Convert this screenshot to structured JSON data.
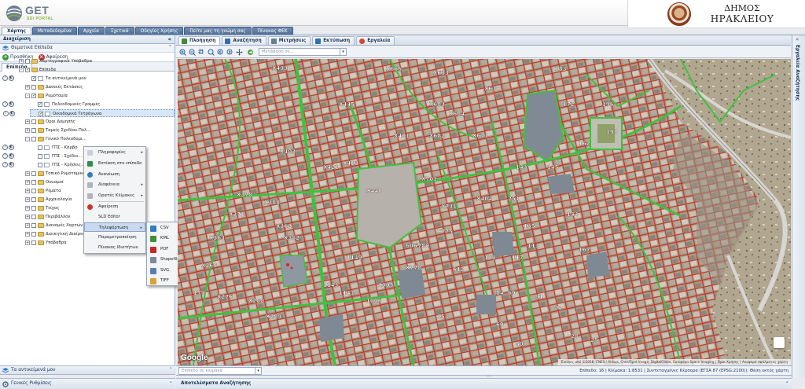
{
  "logo": {
    "name": "GET",
    "subtitle": "SDI PORTAL"
  },
  "brand": {
    "line1": "ΔΗΜΟΣ",
    "line2": "ΗΡΑΚΛΕΙΟΥ"
  },
  "topnav": [
    "Χάρτης",
    "Μεταδεδομένα",
    "Αρχεία",
    "Σχετικά",
    "Οδηγίες Χρήσης",
    "Πείτε μας τη γνώμη σας",
    "Πίνακας ΦΕΚ"
  ],
  "left": {
    "title": "Διαχείριση",
    "section": "Θεματικά Επίπεδα",
    "add_label": "Προσθήκη",
    "remove_label": "Αφαίρεση",
    "subtab": "Επίπεδα",
    "tree": [
      {
        "label": "Χαρτογραφικά Υπόβαθρα",
        "level": 0,
        "type": "folder",
        "expand": "+",
        "checked": false
      },
      {
        "label": "Επίπεδα",
        "level": 0,
        "type": "folder",
        "expand": "-",
        "checked": true
      },
      {
        "label": "Τα αντικείμενά μου",
        "level": 1,
        "type": "layer",
        "expand": "",
        "checked": true,
        "tools": true
      },
      {
        "label": "Δασικές Εκτάσεις",
        "level": 1,
        "type": "folder",
        "expand": "+",
        "checked": false
      },
      {
        "label": "Ρυμοτομία",
        "level": 1,
        "type": "folder",
        "expand": "-",
        "checked": true
      },
      {
        "label": "Πολεοδομικές Γραμμές",
        "level": 2,
        "type": "layer",
        "expand": "",
        "checked": true,
        "tools": true
      },
      {
        "label": "Οικοδομικά Τετράγωνα",
        "level": 2,
        "type": "layer",
        "expand": "",
        "checked": true,
        "tools": true,
        "selected": true
      },
      {
        "label": "Όροι Δόμησης",
        "level": 1,
        "type": "folder",
        "expand": "+",
        "checked": false
      },
      {
        "label": "Ταμείς Σχεδίου Πόλ...",
        "level": 1,
        "type": "folder",
        "expand": "+",
        "checked": false
      },
      {
        "label": "Γενικό Πολεοδομι...",
        "level": 1,
        "type": "folder",
        "expand": "-",
        "checked": false
      },
      {
        "label": "ΓΠΣ - Κάρβο",
        "level": 2,
        "type": "layer",
        "expand": "",
        "checked": false,
        "tools": true
      },
      {
        "label": "ΓΠΣ - Σχέδιο...",
        "level": 2,
        "type": "layer",
        "expand": "",
        "checked": false,
        "tools": true
      },
      {
        "label": "ΓΠΣ - Χρήσεις...",
        "level": 2,
        "type": "layer",
        "expand": "",
        "checked": false,
        "tools": true
      },
      {
        "label": "Τοπικό Ρυμοτομικό...",
        "level": 1,
        "type": "folder",
        "expand": "+",
        "checked": false
      },
      {
        "label": "Οικισμοί",
        "level": 1,
        "type": "folder",
        "expand": "+",
        "checked": false
      },
      {
        "label": "Ρέματα",
        "level": 1,
        "type": "folder",
        "expand": "+",
        "checked": false
      },
      {
        "label": "Αρχαιολογία",
        "level": 1,
        "type": "folder",
        "expand": "+",
        "checked": false
      },
      {
        "label": "Τείχος",
        "level": 1,
        "type": "folder",
        "expand": "+",
        "checked": false
      },
      {
        "label": "Περιβάλλον",
        "level": 1,
        "type": "folder",
        "expand": "+",
        "checked": false
      },
      {
        "label": "Διανομές Χαρτών",
        "level": 1,
        "type": "folder",
        "expand": "+",
        "checked": false
      },
      {
        "label": "Διοικητική Διαίρεση",
        "level": 1,
        "type": "folder",
        "expand": "+",
        "checked": false
      },
      {
        "label": "Υπόβαθρα",
        "level": 1,
        "type": "folder",
        "expand": "+",
        "checked": false
      }
    ],
    "objects_bar": "Τα αντικείμενά μου",
    "general_bar": "Γενικές Ρυθμίσεις"
  },
  "context_menu": [
    {
      "label": "Πληροφορίες",
      "icon": "info-icon",
      "submenu": true
    },
    {
      "label": "Εστίαση στο επίπεδο",
      "icon": "zoom-to-layer-icon",
      "submenu": false
    },
    {
      "label": "Ανανέωση",
      "icon": "refresh-icon",
      "submenu": false
    },
    {
      "label": "Διαφάνεια",
      "icon": "transparency-icon",
      "submenu": true
    },
    {
      "label": "Ορατές Κλίμακες",
      "icon": "scale-icon",
      "submenu": true
    },
    {
      "label": "Αφαίρεση",
      "icon": "remove-icon",
      "submenu": false
    },
    {
      "label": "SLD Editor",
      "icon": "",
      "submenu": false
    },
    {
      "label": "Τηλεφόρτωση",
      "icon": "",
      "submenu": true,
      "highlighted": true
    },
    {
      "label": "Παραμετροποίηση",
      "icon": "",
      "submenu": false
    },
    {
      "label": "Πίνακας Ιδιοτήτων",
      "icon": "",
      "submenu": false
    }
  ],
  "export_menu": [
    {
      "label": "CSV",
      "icon": "csv-icon",
      "color": "#2f7fc1"
    },
    {
      "label": "KML",
      "icon": "kml-icon",
      "color": "#3e8e3e"
    },
    {
      "label": "PDF",
      "icon": "pdf-icon",
      "color": "#c62828"
    },
    {
      "label": "Shapefile",
      "icon": "shapefile-icon",
      "color": "#7a8a9a"
    },
    {
      "label": "SVG",
      "icon": "svg-icon",
      "color": "#5d7db0"
    },
    {
      "label": "TIFF",
      "icon": "tiff-icon",
      "color": "#d8a13a"
    }
  ],
  "map_tabs": [
    {
      "label": "Πλοήγηση",
      "icon": "navigation-icon",
      "active": true
    },
    {
      "label": "Αναζήτηση",
      "icon": "search-icon",
      "active": false
    },
    {
      "label": "Μετρήσεις",
      "icon": "measure-icon",
      "active": false
    },
    {
      "label": "Εκτύπωση",
      "icon": "print-icon",
      "active": false
    },
    {
      "label": "Εργαλεία",
      "icon": "tools-icon",
      "active": false
    }
  ],
  "map_toolbar": {
    "goto_placeholder": "Μετάβαση σε..."
  },
  "map": {
    "google": "Google",
    "attribution": "Εικόνες από ©2018, CNES / Airbus, Cnes/Spot Image, DigitalGlobe, European Space Imaging | Όροι Χρήσης | Αναφορά σφάλματος χάρτη",
    "labels": [
      {
        "t": "X433"
      },
      {
        "t": "X666"
      },
      {
        "t": "X633"
      },
      {
        "t": "X630"
      },
      {
        "t": "X445"
      },
      {
        "t": "X683"
      },
      {
        "t": "X684"
      },
      {
        "t": "X682"
      },
      {
        "t": "X671"
      },
      {
        "t": "X401"
      },
      {
        "t": "X403"
      },
      {
        "t": "X413"
      },
      {
        "t": "X421"
      },
      {
        "t": "X440"
      },
      {
        "t": "X701"
      },
      {
        "t": "X731"
      },
      {
        "t": "X775"
      },
      {
        "t": "X780"
      },
      {
        "t": "X778"
      },
      {
        "t": "X404"
      },
      {
        "t": "X388"
      },
      {
        "t": "X362"
      },
      {
        "t": "X382"
      },
      {
        "t": "X378"
      },
      {
        "t": "X371"
      },
      {
        "t": "X363"
      },
      {
        "t": "X268"
      },
      {
        "t": "X276"
      },
      {
        "t": "X280"
      },
      {
        "t": "X289"
      },
      {
        "t": "196"
      },
      {
        "t": "197"
      },
      {
        "t": "162"
      },
      {
        "t": "143"
      },
      {
        "t": "145"
      },
      {
        "t": "135"
      },
      {
        "t": "183"
      },
      {
        "t": "172"
      },
      {
        "t": "1149"
      },
      {
        "t": "1143"
      },
      {
        "t": "1141"
      },
      {
        "t": "606"
      },
      {
        "t": "612"
      },
      {
        "t": "101"
      },
      {
        "t": "113"
      },
      {
        "t": "117"
      },
      {
        "t": "91"
      },
      {
        "t": "84"
      },
      {
        "t": "28"
      },
      {
        "t": "25"
      },
      {
        "t": "77"
      },
      {
        "t": "69"
      },
      {
        "t": "60"
      },
      {
        "t": "50"
      },
      {
        "t": "1005"
      },
      {
        "t": "1006"
      },
      {
        "t": "144"
      },
      {
        "t": "167"
      },
      {
        "t": "179"
      },
      {
        "t": "251"
      },
      {
        "t": "153"
      }
    ]
  },
  "right_tools": "Εργαλεία Αναζήτησης",
  "status": {
    "search_placeholder": "Επίπεδο σε κλίμακα",
    "text": "Επίπεδο: 16 | Κλίμακα: 1:8531 | Συντεταγμένες Κέρσορα (ΕΓΣΑ 87 (EPSG:2100)): Θέση εκτός χάρτη"
  },
  "results_bar": "Αποτελέσματα Αναζήτησης",
  "colors": {
    "accent": "#4f6d95",
    "parcel_outline": "#c62a1a",
    "green_line": "#3fc13f"
  }
}
